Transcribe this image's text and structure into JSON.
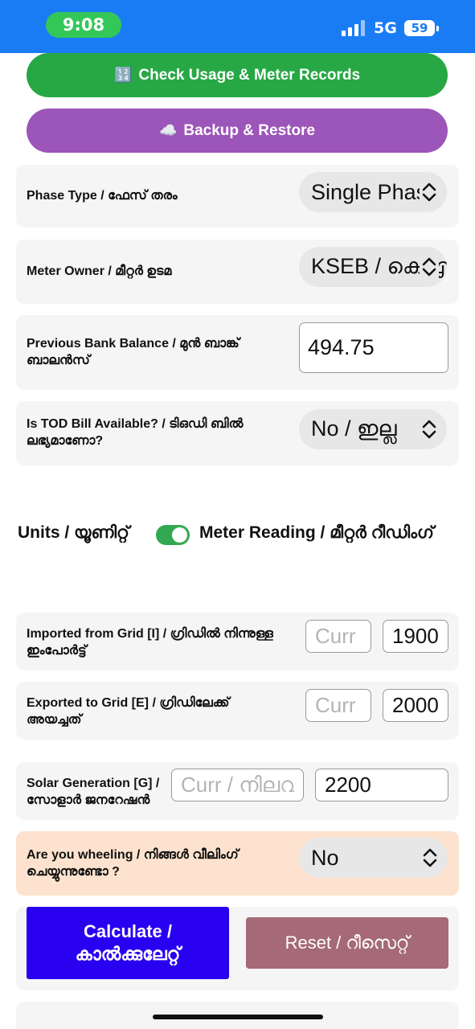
{
  "status_bar": {
    "time": "9:08",
    "network": "5G",
    "battery": "59"
  },
  "buttons": {
    "check_usage": {
      "icon": "1234-icon",
      "icon_glyph": "🔢",
      "label": "Check Usage & Meter Records"
    },
    "backup": {
      "icon": "cloud-icon",
      "icon_glyph": "☁️",
      "label": "Backup & Restore"
    }
  },
  "phase": {
    "label": "Phase Type / ഫേസ് തരം",
    "value": "Single Phase"
  },
  "meter_owner": {
    "label": "Meter Owner / മീറ്റർ ഉടമ",
    "value": "KSEB / കെഎസ്ഇബി"
  },
  "bank_balance": {
    "label": "Previous Bank Balance / മുൻ ബാങ്ക് ബാലൻസ്",
    "value": "494.75"
  },
  "tod": {
    "label": "Is TOD Bill Available? / ടിഒഡി ബിൽ ലഭ്യമാണോ?",
    "value": "No / ഇല്ല"
  },
  "mode_toggle": {
    "left_label": "Units / യൂണിറ്റ്",
    "right_label": "Meter Reading / മീറ്റർ റീഡിംഗ്",
    "checked": true
  },
  "imported": {
    "label": "Imported from Grid [I] / ഗ്രിഡിൽ നിന്നുള്ള ഇംപോർട്ട്",
    "placeholder": "Curr / നിലവിലെ",
    "value": "1900"
  },
  "exported": {
    "label": "Exported to Grid [E] / ഗ്രിഡിലേക്ക് അയച്ചത്",
    "placeholder": "Curr / നിലവിലെ",
    "value": "2000"
  },
  "solar": {
    "label": "Solar Generation [G] / സോളാർ ജനറേഷൻ",
    "placeholder": "Curr / നിലവിലെ",
    "value": "2200"
  },
  "wheeling": {
    "label": "Are you wheeling / നിങ്ങൾ വീലിംഗ് ചെയ്യുന്നുണ്ടോ ?",
    "value": "No"
  },
  "calculate": {
    "label": "Calculate / കാൽക്കുലേറ്റ്"
  },
  "reset": {
    "label": "Reset / റീസെറ്റ്"
  },
  "colors": {
    "status_bar": "#1a7cf5",
    "check_usage": "#27a844",
    "backup": "#9c55b8",
    "calculate": "#2a00f0",
    "reset": "#a56a75",
    "wheeling_card": "#fde3cf",
    "toggle_on": "#33a853"
  }
}
